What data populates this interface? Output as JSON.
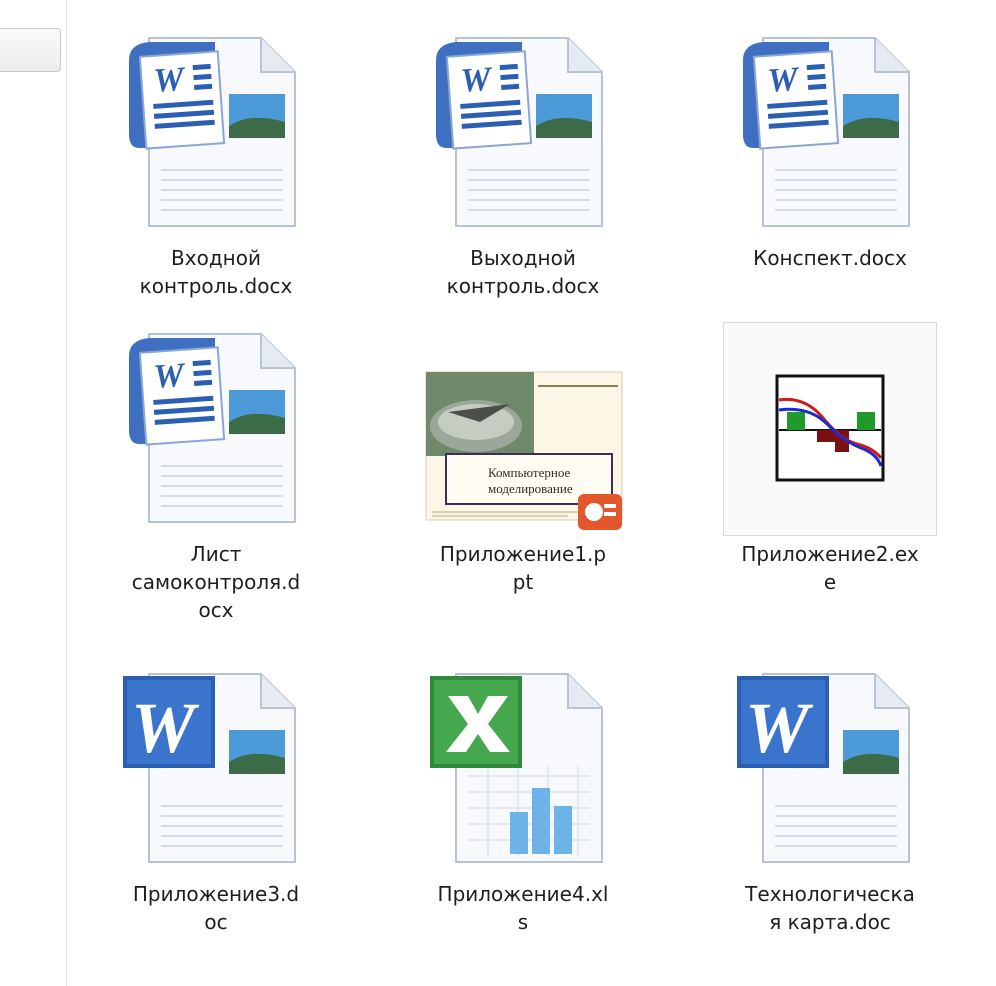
{
  "files": [
    {
      "name": "Входной\nконтроль.docx",
      "type": "docx"
    },
    {
      "name": "Выходной\nконтроль.docx",
      "type": "docx"
    },
    {
      "name": "Конспект.docx",
      "type": "docx"
    },
    {
      "name": "Лист\nсамоконтроля.d\nocx",
      "type": "docx"
    },
    {
      "name": "Приложение1.p\npt",
      "type": "ppt",
      "preview_text": "Компьютерное\nмоделирование"
    },
    {
      "name": "Приложение2.ex\ne",
      "type": "exe"
    },
    {
      "name": "Приложение3.d\noc",
      "type": "doc"
    },
    {
      "name": "Приложение4.xl\ns",
      "type": "xls"
    },
    {
      "name": "Технологическа\nя карта.doc",
      "type": "doc"
    }
  ],
  "colors": {
    "word_blue": "#2b5fb4",
    "excel_green": "#2f8a3a",
    "ppt_orange": "#e2572b",
    "label_text": "#1e1e1e"
  }
}
